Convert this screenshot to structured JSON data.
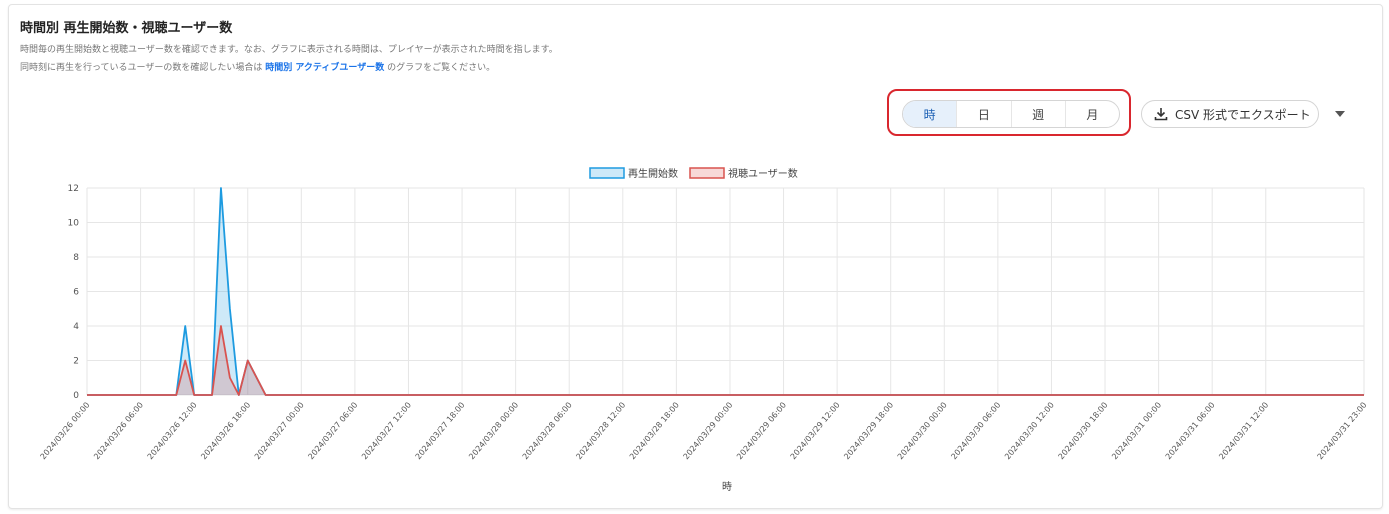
{
  "header": {
    "title": "時間別 再生開始数・視聴ユーザー数",
    "desc1": "時間毎の再生開始数と視聴ユーザー数を確認できます。なお、グラフに表示される時間は、プレイヤーが表示された時間を指します。",
    "desc2_pre": "同時刻に再生を行っているユーザーの数を確認したい場合は ",
    "desc2_link": "時間別 アクティブユーザー数",
    "desc2_post": " のグラフをご覧ください。"
  },
  "controls": {
    "granularity": [
      "時",
      "日",
      "週",
      "月"
    ],
    "selected": "時",
    "export_label": "CSV 形式でエクスポート"
  },
  "icons": {
    "download": "download-icon",
    "dropdown": "chevron-down-icon"
  },
  "colors": {
    "accent": "#1a73e8",
    "highlight_border": "#d9272e",
    "series1": "#1e9be0",
    "series2": "#d9534f"
  },
  "chart_data": {
    "type": "area",
    "xlabel": "時",
    "ylabel": "",
    "ylim": [
      0,
      12
    ],
    "yticks": [
      0,
      2,
      4,
      6,
      8,
      10,
      12
    ],
    "xticks": [
      "2024/03/26 00:00",
      "2024/03/26 06:00",
      "2024/03/26 12:00",
      "2024/03/26 18:00",
      "2024/03/27 00:00",
      "2024/03/27 06:00",
      "2024/03/27 12:00",
      "2024/03/27 18:00",
      "2024/03/28 00:00",
      "2024/03/28 06:00",
      "2024/03/28 12:00",
      "2024/03/28 18:00",
      "2024/03/29 00:00",
      "2024/03/29 06:00",
      "2024/03/29 12:00",
      "2024/03/29 18:00",
      "2024/03/30 00:00",
      "2024/03/30 06:00",
      "2024/03/30 12:00",
      "2024/03/30 18:00",
      "2024/03/31 00:00",
      "2024/03/31 06:00",
      "2024/03/31 12:00",
      "2024/03/31 23:00"
    ],
    "x_start": "2024/03/26 00:00",
    "x_end": "2024/03/31 23:00",
    "legend_position": "top-center",
    "grid": true,
    "series": [
      {
        "name": "再生開始数",
        "color": "#1e9be0",
        "fill": "rgba(30,155,224,0.22)",
        "points": [
          [
            "2024/03/26 00:00",
            0
          ],
          [
            "2024/03/26 10:00",
            0
          ],
          [
            "2024/03/26 11:00",
            4
          ],
          [
            "2024/03/26 12:00",
            0
          ],
          [
            "2024/03/26 14:00",
            0
          ],
          [
            "2024/03/26 15:00",
            12
          ],
          [
            "2024/03/26 16:00",
            5
          ],
          [
            "2024/03/26 17:00",
            0
          ],
          [
            "2024/03/26 18:00",
            2
          ],
          [
            "2024/03/26 19:00",
            1
          ],
          [
            "2024/03/26 20:00",
            0
          ],
          [
            "2024/03/31 23:00",
            0
          ]
        ]
      },
      {
        "name": "視聴ユーザー数",
        "color": "#d9534f",
        "fill": "rgba(217,83,79,0.22)",
        "points": [
          [
            "2024/03/26 00:00",
            0
          ],
          [
            "2024/03/26 10:00",
            0
          ],
          [
            "2024/03/26 11:00",
            2
          ],
          [
            "2024/03/26 12:00",
            0
          ],
          [
            "2024/03/26 14:00",
            0
          ],
          [
            "2024/03/26 15:00",
            4
          ],
          [
            "2024/03/26 16:00",
            1
          ],
          [
            "2024/03/26 17:00",
            0
          ],
          [
            "2024/03/26 18:00",
            2
          ],
          [
            "2024/03/26 19:00",
            1
          ],
          [
            "2024/03/26 20:00",
            0
          ],
          [
            "2024/03/31 23:00",
            0
          ]
        ]
      }
    ]
  }
}
